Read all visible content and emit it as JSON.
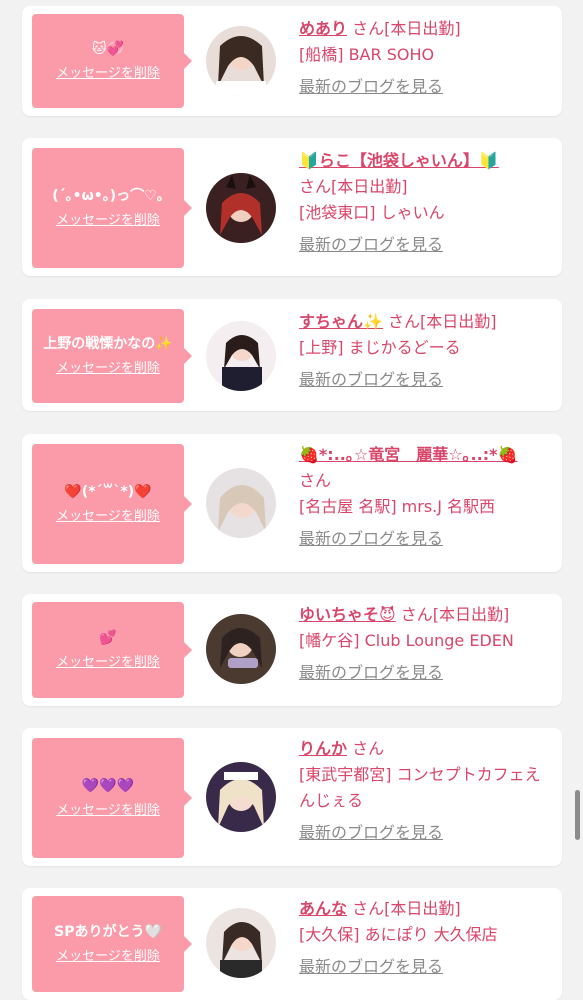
{
  "delete_label": "メッセージを削除",
  "blog_label": "最新のブログを見る",
  "cards": [
    {
      "message": "🐱💞",
      "name": "めあり",
      "san": "さん[本日出勤]",
      "shop": "[船橋] BAR SOHO"
    },
    {
      "message": "(´｡•ω•｡)っ⌒♡｡",
      "name": "🔰らこ【池袋しゃいん】🔰",
      "san": "さん[本日出勤]",
      "shop": "[池袋東口] しゃいん"
    },
    {
      "message": "上野の戦慄かなの✨",
      "name": "すちゃん✨",
      "san": "さん[本日出勤]",
      "shop": "[上野] まじかるどーる"
    },
    {
      "message": "❤️(*´꒳`*)❤️",
      "name": "🍓*:..｡☆竜宮　麗華☆｡..:*🍓",
      "san": "さん",
      "shop": "[名古屋 名駅] mrs.J 名駅西"
    },
    {
      "message": "💕",
      "name": "ゆいちゃそ😈",
      "san": "さん[本日出勤]",
      "shop": "[幡ケ谷] Club Lounge EDEN"
    },
    {
      "message": "💜💜💜",
      "name": "りんか",
      "san": "さん",
      "shop": "[東武宇都宮] コンセプトカフェえんじぇる"
    },
    {
      "message": "SPありがとう🤍",
      "name": "あんな",
      "san": "さん[本日出勤]",
      "shop": "[大久保] あにぽり 大久保店"
    }
  ],
  "colors": {
    "accent": "#d9466a",
    "bubble": "#fb9aa8",
    "muted": "#8a8a8a"
  }
}
